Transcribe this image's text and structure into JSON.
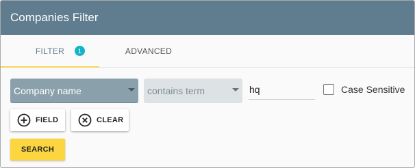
{
  "header": {
    "title": "Companies Filter"
  },
  "tabs": [
    {
      "label": "FILTER",
      "badge": "1"
    },
    {
      "label": "ADVANCED"
    }
  ],
  "filter_row": {
    "field_select": {
      "selected": "Company name"
    },
    "operator_select": {
      "selected": "contains term"
    },
    "term_input": {
      "value": "hq"
    },
    "case_sensitive": {
      "label": "Case Sensitive",
      "checked": false
    }
  },
  "buttons": {
    "add_field": {
      "label": "FIELD",
      "icon": "plus-circle-icon"
    },
    "clear": {
      "label": "CLEAR",
      "icon": "x-circle-icon"
    },
    "search": {
      "label": "SEARCH"
    }
  },
  "colors": {
    "header_bg": "#5f7d8e",
    "badge": "#14b4c8",
    "active_tab_underline": "#f4d35e",
    "search_button": "#fbd640",
    "field_select_bg": "#8aa1ac"
  }
}
